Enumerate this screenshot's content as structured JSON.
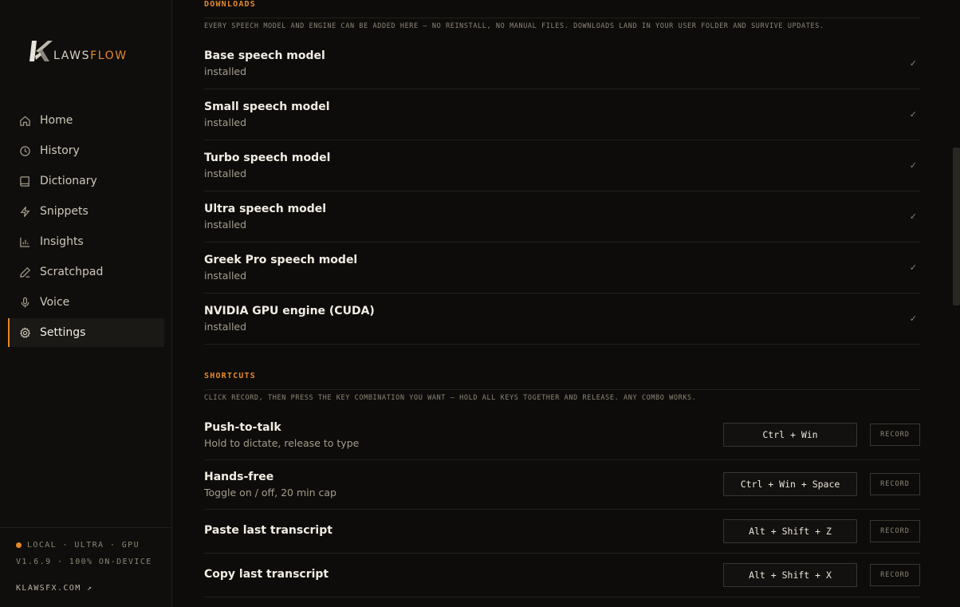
{
  "brand": {
    "name_part1": "LAWS",
    "name_part2": "FLOW"
  },
  "sidebar": {
    "items": [
      {
        "label": "Home",
        "icon": "home-icon"
      },
      {
        "label": "History",
        "icon": "clock-icon"
      },
      {
        "label": "Dictionary",
        "icon": "book-icon"
      },
      {
        "label": "Snippets",
        "icon": "bolt-icon"
      },
      {
        "label": "Insights",
        "icon": "bar-chart-icon"
      },
      {
        "label": "Scratchpad",
        "icon": "pen-icon"
      },
      {
        "label": "Voice",
        "icon": "microphone-icon"
      },
      {
        "label": "Settings",
        "icon": "gear-icon"
      }
    ],
    "active": "Settings",
    "footer": {
      "status": "LOCAL · ULTRA · GPU",
      "version": "V1.6.9 · 100% ON-DEVICE",
      "link": "KLAWSFX.COM ↗"
    }
  },
  "colors": {
    "accent": "#e6882c",
    "background": "#0d0c0a"
  },
  "downloads": {
    "title": "DOWNLOADS",
    "description": "EVERY SPEECH MODEL AND ENGINE CAN BE ADDED HERE — NO REINSTALL, NO MANUAL FILES. DOWNLOADS LAND IN YOUR USER FOLDER AND SURVIVE UPDATES.",
    "items": [
      {
        "name": "Base speech model",
        "status": "installed",
        "mark": "✓"
      },
      {
        "name": "Small speech model",
        "status": "installed",
        "mark": "✓"
      },
      {
        "name": "Turbo speech model",
        "status": "installed",
        "mark": "✓"
      },
      {
        "name": "Ultra speech model",
        "status": "installed",
        "mark": "✓"
      },
      {
        "name": "Greek Pro speech model",
        "status": "installed",
        "mark": "✓"
      },
      {
        "name": "NVIDIA GPU engine (CUDA)",
        "status": "installed",
        "mark": "✓"
      }
    ]
  },
  "shortcuts": {
    "title": "SHORTCUTS",
    "description": "CLICK RECORD, THEN PRESS THE KEY COMBINATION YOU WANT — HOLD ALL KEYS TOGETHER AND RELEASE. ANY COMBO WORKS.",
    "record_label": "RECORD",
    "items": [
      {
        "name": "Push-to-talk",
        "sub": "Hold to dictate, release to type",
        "keys": "Ctrl + Win"
      },
      {
        "name": "Hands-free",
        "sub": "Toggle on / off, 20 min cap",
        "keys": "Ctrl + Win + Space"
      },
      {
        "name": "Paste last transcript",
        "sub": "",
        "keys": "Alt + Shift + Z"
      },
      {
        "name": "Copy last transcript",
        "sub": "",
        "keys": "Alt + Shift + X"
      }
    ]
  }
}
